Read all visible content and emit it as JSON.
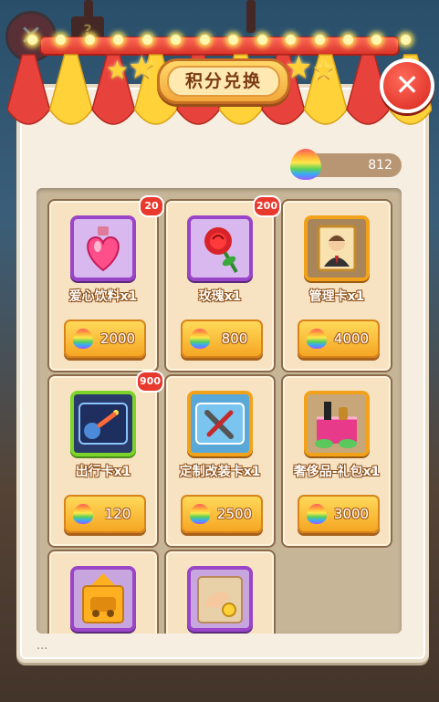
{
  "title": "积分兑换",
  "currency": {
    "value": "812",
    "icon": "rainbow-drop-icon"
  },
  "background": {
    "close_glyph": "✕",
    "sign_glyph": "?",
    "under_text": "..."
  },
  "close_glyph": "✕",
  "colors": {
    "awning_red": "#e8423c",
    "awning_yellow": "#ffd23a",
    "panel": "#f6eee0",
    "price_button": "#f5a623"
  },
  "items": [
    {
      "name": "爱心饮料x1",
      "price": "2000",
      "badge": "20",
      "icon": "heart-potion-icon"
    },
    {
      "name": "玫瑰x1",
      "price": "800",
      "badge": "200",
      "icon": "rose-icon"
    },
    {
      "name": "管理卡x1",
      "price": "4000",
      "badge": "",
      "icon": "manager-card-icon"
    },
    {
      "name": "出行卡x1",
      "price": "120",
      "badge": "900",
      "icon": "travel-card-icon"
    },
    {
      "name": "定制改装卡x1",
      "price": "2500",
      "badge": "",
      "icon": "modify-card-icon"
    },
    {
      "name": "奢侈品-礼包x1",
      "price": "3000",
      "badge": "",
      "icon": "luxury-gift-icon"
    },
    {
      "name": "",
      "price": "",
      "badge": "",
      "icon": "car-card-icon"
    },
    {
      "name": "",
      "price": "",
      "badge": "",
      "icon": "hand-coin-card-icon"
    }
  ]
}
